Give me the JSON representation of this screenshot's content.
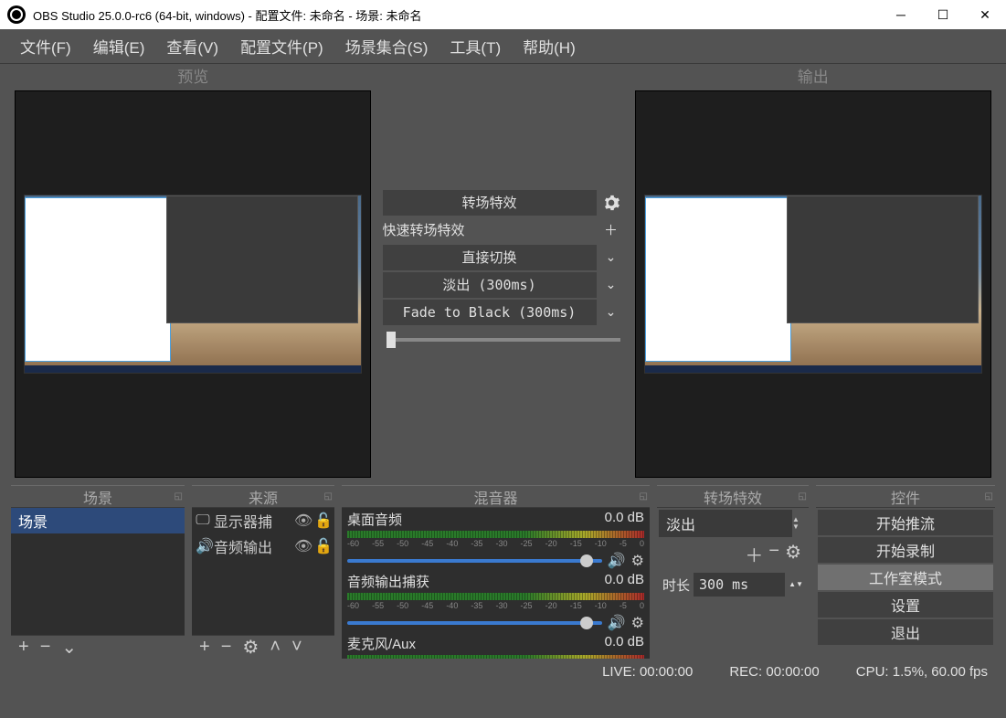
{
  "window": {
    "title": "OBS Studio 25.0.0-rc6 (64-bit, windows) - 配置文件: 未命名 - 场景: 未命名"
  },
  "menu": [
    "文件(F)",
    "编辑(E)",
    "查看(V)",
    "配置文件(P)",
    "场景集合(S)",
    "工具(T)",
    "帮助(H)"
  ],
  "studio": {
    "preview_label": "预览",
    "output_label": "输出",
    "trans_btn": "转场特效",
    "quick_label": "快速转场特效",
    "cut": "直接切换",
    "fade": "淡出 (300ms)",
    "ftb": "Fade to Black (300ms)"
  },
  "panels": {
    "scenes": {
      "title": "场景",
      "items": [
        "场景"
      ]
    },
    "sources": {
      "title": "来源",
      "items": [
        {
          "icon": "monitor",
          "name": "显示器捕",
          "visible": true,
          "locked": false
        },
        {
          "icon": "speaker",
          "name": "音频输出",
          "visible": true,
          "locked": false
        }
      ]
    },
    "mixer": {
      "title": "混音器",
      "ticks": [
        "-60",
        "-55",
        "-50",
        "-45",
        "-40",
        "-35",
        "-30",
        "-25",
        "-20",
        "-15",
        "-10",
        "-5",
        "0"
      ],
      "channels": [
        {
          "name": "桌面音频",
          "db": "0.0 dB"
        },
        {
          "name": "音频输出捕获",
          "db": "0.0 dB"
        },
        {
          "name": "麦克风/Aux",
          "db": "0.0 dB"
        }
      ]
    },
    "transition": {
      "title": "转场特效",
      "selected": "淡出",
      "duration_label": "时长",
      "duration_value": "300 ms"
    },
    "controls": {
      "title": "控件",
      "buttons": [
        "开始推流",
        "开始录制",
        "工作室模式",
        "设置",
        "退出"
      ],
      "active_index": 2
    }
  },
  "status": {
    "live": "LIVE: 00:00:00",
    "rec": "REC: 00:00:00",
    "cpu": "CPU: 1.5%, 60.00 fps"
  }
}
